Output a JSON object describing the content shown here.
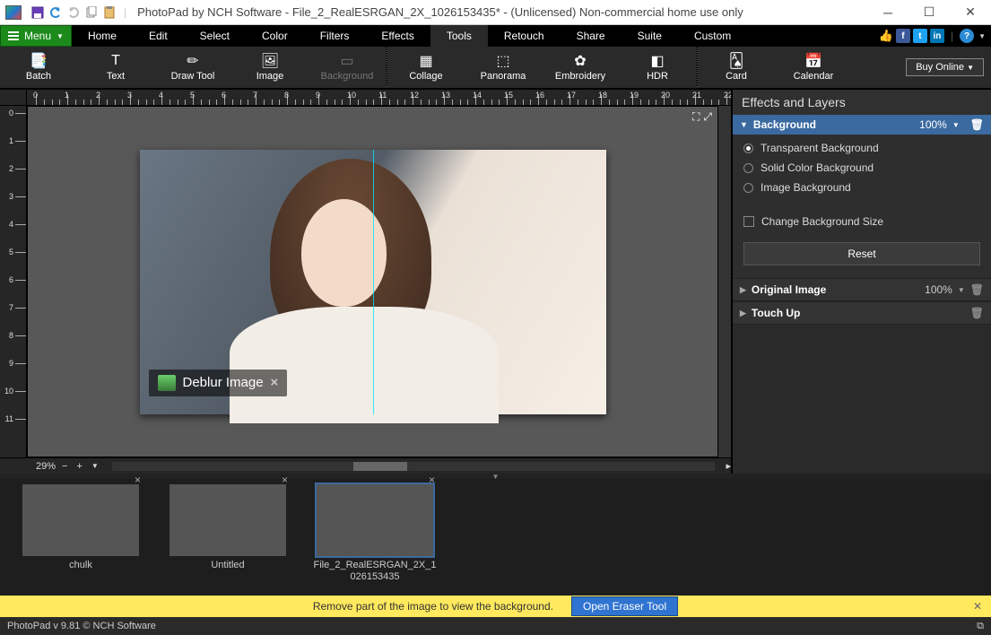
{
  "title": "PhotoPad by NCH Software - File_2_RealESRGAN_2X_1026153435* - (Unlicensed) Non-commercial home use only",
  "menu_dropdown": "Menu",
  "menus": [
    "Home",
    "Edit",
    "Select",
    "Color",
    "Filters",
    "Effects",
    "Tools",
    "Retouch",
    "Share",
    "Suite",
    "Custom"
  ],
  "active_menu": "Tools",
  "ribbon": {
    "left": [
      {
        "icon": "📑",
        "label": "Batch"
      },
      {
        "icon": "T",
        "label": "Text"
      },
      {
        "icon": "✏",
        "label": "Draw Tool"
      },
      {
        "icon": "🖼",
        "label": "Image"
      },
      {
        "icon": "▭",
        "label": "Background",
        "disabled": true
      }
    ],
    "right": [
      {
        "icon": "▦",
        "label": "Collage"
      },
      {
        "icon": "⬚",
        "label": "Panorama"
      },
      {
        "icon": "✿",
        "label": "Embroidery"
      },
      {
        "icon": "◧",
        "label": "HDR"
      }
    ],
    "far": [
      {
        "icon": "🂡",
        "label": "Card"
      },
      {
        "icon": "📅",
        "label": "Calendar"
      }
    ],
    "buy": "Buy Online"
  },
  "zoom": "29%",
  "deblur_chip": "Deblur Image",
  "side": {
    "title": "Effects and Layers",
    "background": {
      "label": "Background",
      "opacity": "100%",
      "options": [
        "Transparent Background",
        "Solid Color Background",
        "Image Background"
      ],
      "selected": 0,
      "checkbox": "Change Background Size",
      "reset": "Reset"
    },
    "original": {
      "label": "Original Image",
      "opacity": "100%"
    },
    "touchup": {
      "label": "Touch Up"
    }
  },
  "thumbs": [
    {
      "name": "chulk"
    },
    {
      "name": "Untitled"
    },
    {
      "name": "File_2_RealESRGAN_2X_1026153435",
      "selected": true
    }
  ],
  "yellow": {
    "text": "Remove part of the image to view the background.",
    "button": "Open Eraser Tool"
  },
  "status": "PhotoPad v 9.81 © NCH Software"
}
